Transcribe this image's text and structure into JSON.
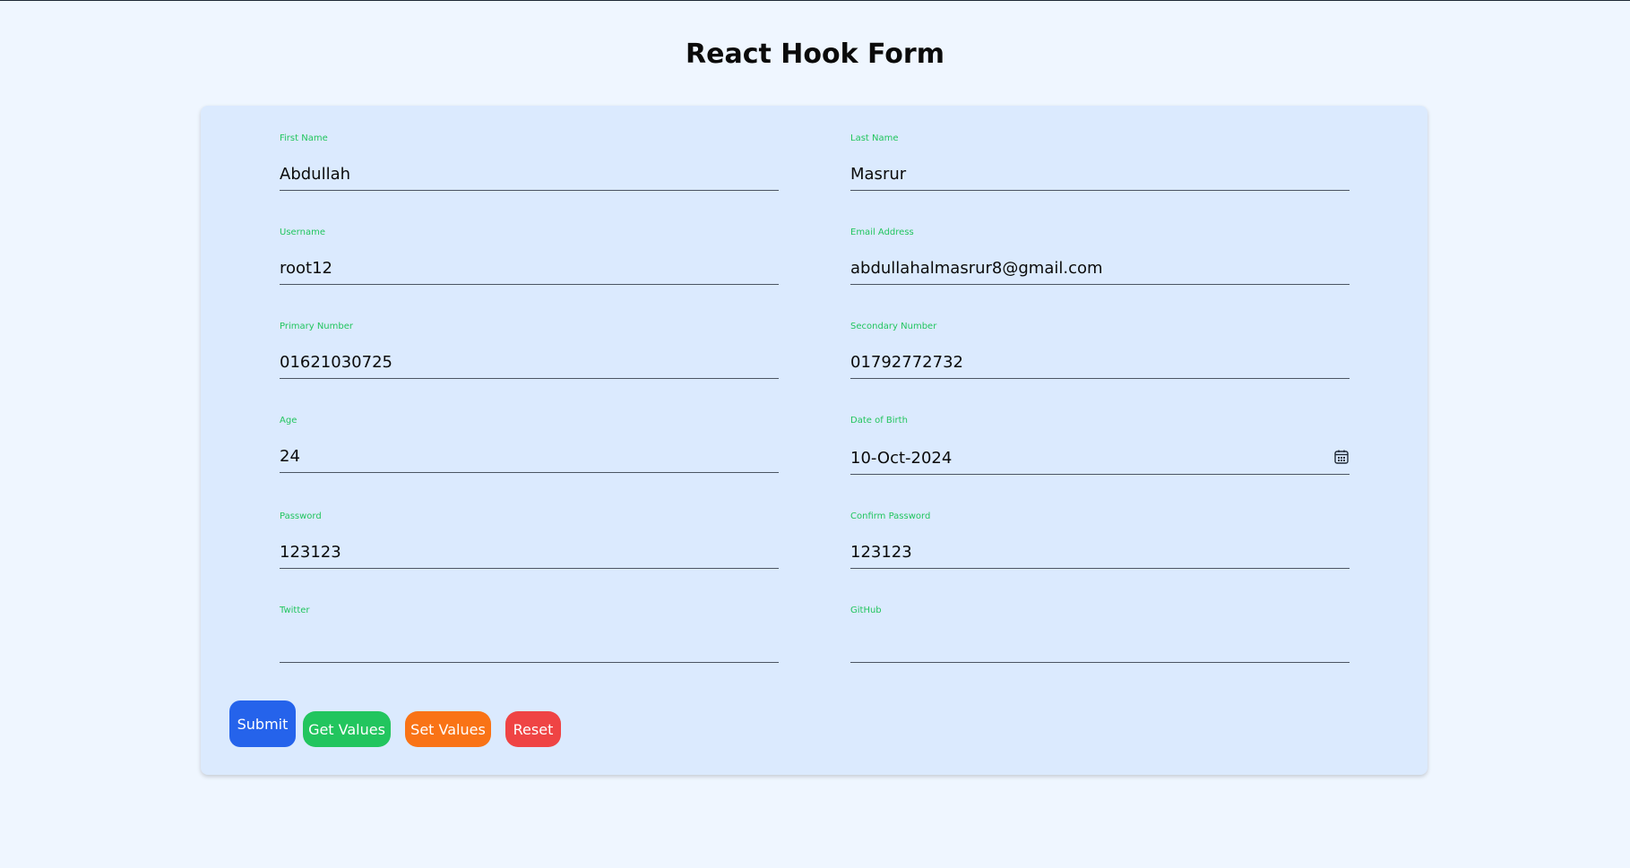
{
  "page": {
    "title": "React Hook Form"
  },
  "form": {
    "first_name": {
      "label": "First Name",
      "value": "Abdullah"
    },
    "last_name": {
      "label": "Last Name",
      "value": "Masrur"
    },
    "username": {
      "label": "Username",
      "value": "root12"
    },
    "email": {
      "label": "Email Address",
      "value": "abdullahalmasrur8@gmail.com"
    },
    "primary_number": {
      "label": "Primary Number",
      "value": "01621030725"
    },
    "secondary_number": {
      "label": "Secondary Number",
      "value": "01792772732"
    },
    "age": {
      "label": "Age",
      "value": "24"
    },
    "date_of_birth": {
      "label": "Date of Birth",
      "value": "10-Oct-2024",
      "icon": "calendar-icon"
    },
    "password": {
      "label": "Password",
      "value": "123123"
    },
    "confirm_password": {
      "label": "Confirm Password",
      "value": "123123"
    },
    "twitter": {
      "label": "Twitter",
      "value": ""
    },
    "github": {
      "label": "GitHub",
      "value": ""
    }
  },
  "buttons": {
    "submit": "Submit",
    "get_values": "Get Values",
    "set_values": "Set Values",
    "reset": "Reset"
  },
  "colors": {
    "page_background": "#eff6ff",
    "card_background": "#dbeafe",
    "label": "#22c55e",
    "submit": "#2563eb",
    "get_values": "#22c55e",
    "set_values": "#f97316",
    "reset": "#ef4444"
  }
}
